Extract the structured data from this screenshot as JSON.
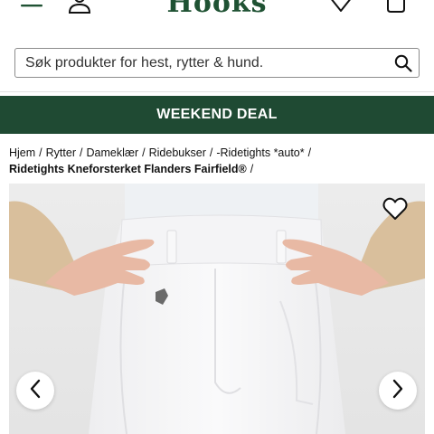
{
  "header": {
    "brand": "Hooks",
    "icons": [
      "menu-icon",
      "user-icon",
      "heart-icon",
      "cart-icon"
    ]
  },
  "search": {
    "placeholder": "Søk produkter for hest, rytter & hund.",
    "icon": "search-icon"
  },
  "banner": {
    "text": "WEEKEND DEAL",
    "color": "#1f4a33"
  },
  "breadcrumb": {
    "items": [
      "Hjem",
      "Rytter",
      "Dameklær",
      "Ridebukser",
      "-Ridetights *auto*"
    ],
    "separator": "/",
    "current": "Ridetights Kneforsterket Flanders Fairfield®"
  },
  "product_image": {
    "favorite_icon": "heart-outline-icon",
    "prev_icon": "chevron-left-icon",
    "next_icon": "chevron-right-icon"
  },
  "colors": {
    "brand_green": "#1f5233",
    "banner_green": "#1f4a33"
  }
}
